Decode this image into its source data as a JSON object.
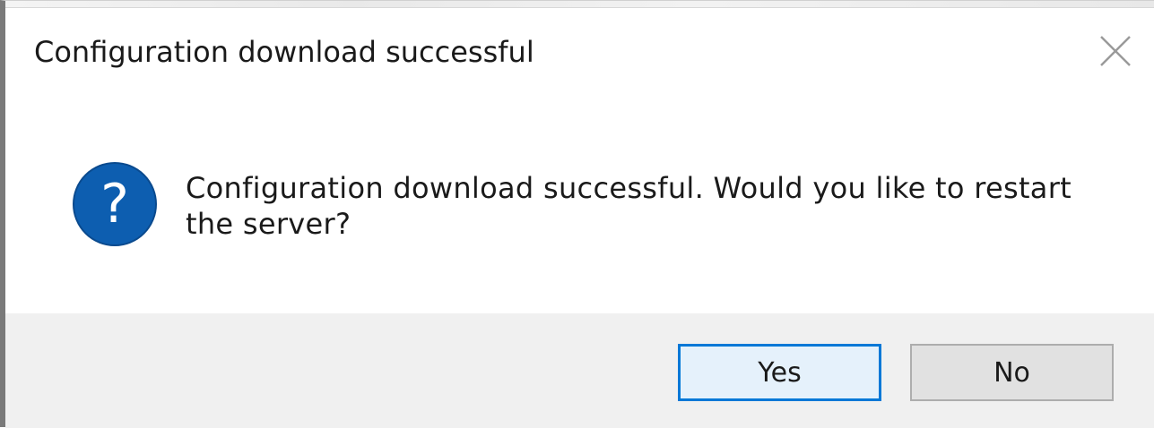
{
  "dialog": {
    "title": "Configuration download successful",
    "message": "Configuration download successful. Would you like to restart the server?",
    "icon": "question-icon",
    "colors": {
      "icon_blue": "#0d5eb0",
      "accent": "#0078d7"
    },
    "buttons": {
      "yes_label": "Yes",
      "no_label": "No"
    }
  }
}
